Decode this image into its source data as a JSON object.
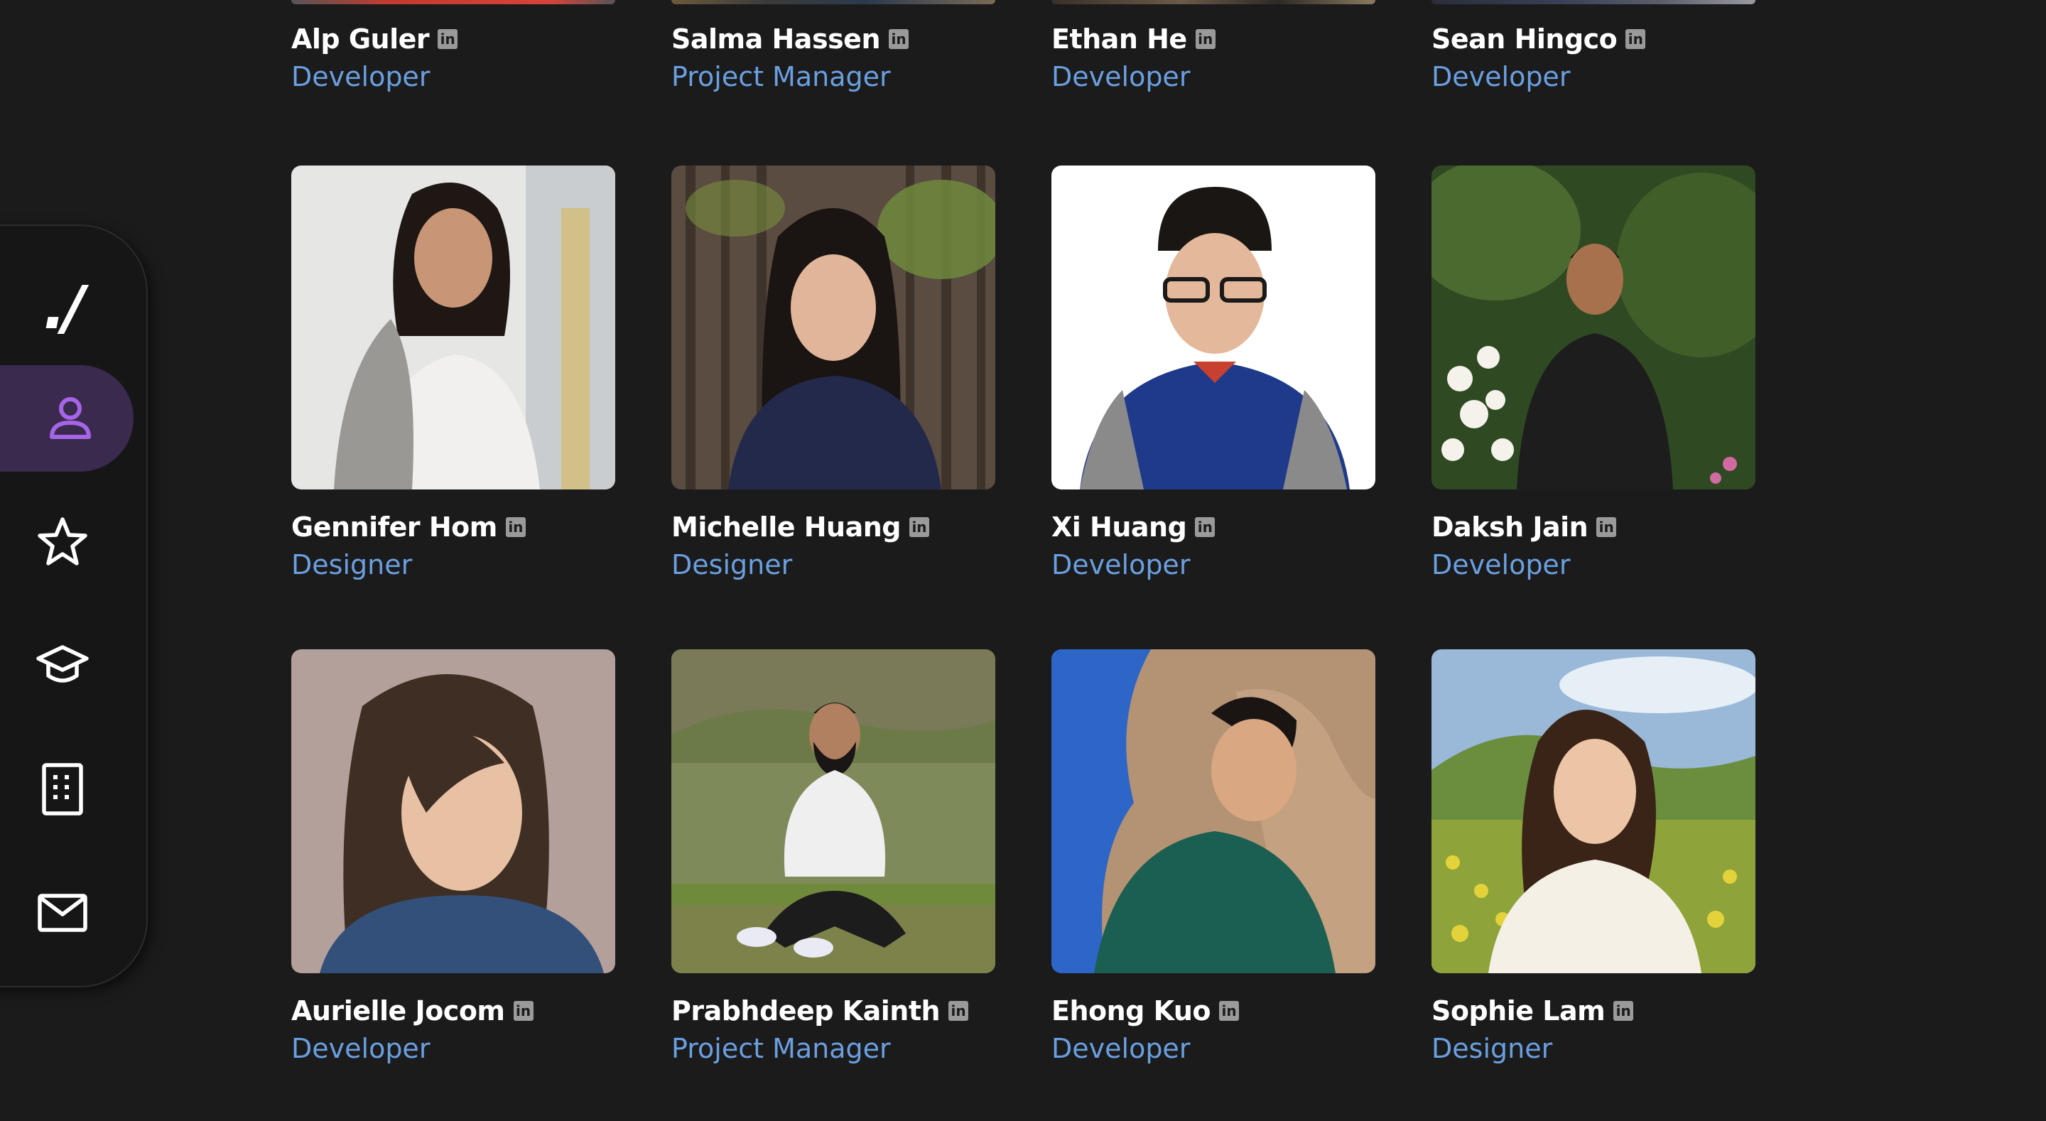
{
  "nav": {
    "logo": "./",
    "items": [
      {
        "name": "profile-icon",
        "active": true
      },
      {
        "name": "star-icon",
        "active": false
      },
      {
        "name": "graduation-cap-icon",
        "active": false
      },
      {
        "name": "document-list-icon",
        "active": false
      },
      {
        "name": "mail-icon",
        "active": false
      }
    ],
    "accent_color": "#a565e6"
  },
  "linkedin_label": "in",
  "team": {
    "top_row": [
      {
        "name": "Alp Guler",
        "role": "Developer"
      },
      {
        "name": "Salma Hassen",
        "role": "Project Manager"
      },
      {
        "name": "Ethan He",
        "role": "Developer"
      },
      {
        "name": "Sean Hingco",
        "role": "Developer"
      }
    ],
    "row2": [
      {
        "name": "Gennifer Hom",
        "role": "Designer"
      },
      {
        "name": "Michelle Huang",
        "role": "Designer"
      },
      {
        "name": "Xi Huang",
        "role": "Developer"
      },
      {
        "name": "Daksh Jain",
        "role": "Developer"
      }
    ],
    "row3": [
      {
        "name": "Aurielle Jocom",
        "role": "Developer"
      },
      {
        "name": "Prabhdeep Kainth",
        "role": "Project Manager"
      },
      {
        "name": "Ehong Kuo",
        "role": "Developer"
      },
      {
        "name": "Sophie Lam",
        "role": "Designer"
      }
    ]
  },
  "colors": {
    "background": "#1b1b1c",
    "role_text": "#6a9fe0",
    "name_text": "#ffffff"
  }
}
